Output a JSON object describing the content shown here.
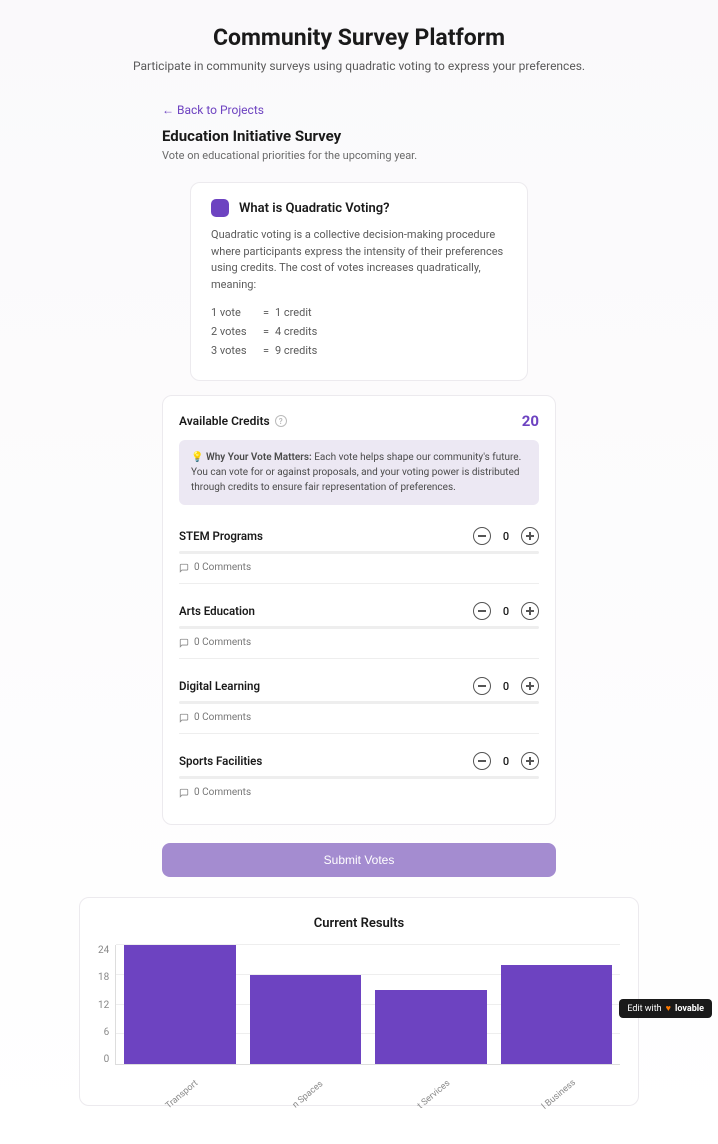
{
  "header": {
    "title": "Community Survey Platform",
    "subtitle": "Participate in community surveys using quadratic voting to express your preferences."
  },
  "nav": {
    "back_label": "← Back to Projects"
  },
  "project": {
    "title": "Education Initiative Survey",
    "description": "Vote on educational priorities for the upcoming year."
  },
  "info": {
    "title": "What is Quadratic Voting?",
    "body": "Quadratic voting is a collective decision-making procedure where participants express the intensity of their preferences using credits. The cost of votes increases quadratically, meaning:",
    "pricing": [
      {
        "votes": "1 vote",
        "eq": "=",
        "credits": "1 credit"
      },
      {
        "votes": "2 votes",
        "eq": "=",
        "credits": "4 credits"
      },
      {
        "votes": "3 votes",
        "eq": "=",
        "credits": "9 credits"
      }
    ]
  },
  "credits": {
    "label": "Available Credits",
    "value": "20"
  },
  "banner": {
    "emoji": "💡",
    "bold": "Why Your Vote Matters:",
    "text": " Each vote helps shape our community's future. You can vote for or against proposals, and your voting power is distributed through credits to ensure fair representation of preferences."
  },
  "items": [
    {
      "name": "STEM Programs",
      "count": "0",
      "comments": "0 Comments"
    },
    {
      "name": "Arts Education",
      "count": "0",
      "comments": "0 Comments"
    },
    {
      "name": "Digital Learning",
      "count": "0",
      "comments": "0 Comments"
    },
    {
      "name": "Sports Facilities",
      "count": "0",
      "comments": "0 Comments"
    }
  ],
  "submit_label": "Submit Votes",
  "results": {
    "title": "Current Results"
  },
  "chart_data": {
    "type": "bar",
    "categories": [
      "Transport",
      "n Spaces",
      "t Services",
      "l Business"
    ],
    "values": [
      24,
      18,
      15,
      20
    ],
    "title": "Current Results",
    "xlabel": "",
    "ylabel": "",
    "ylim": [
      0,
      24
    ],
    "yticks": [
      0,
      6,
      12,
      18,
      24
    ]
  },
  "badge": {
    "prefix": "Edit with",
    "brand": "lovable"
  }
}
